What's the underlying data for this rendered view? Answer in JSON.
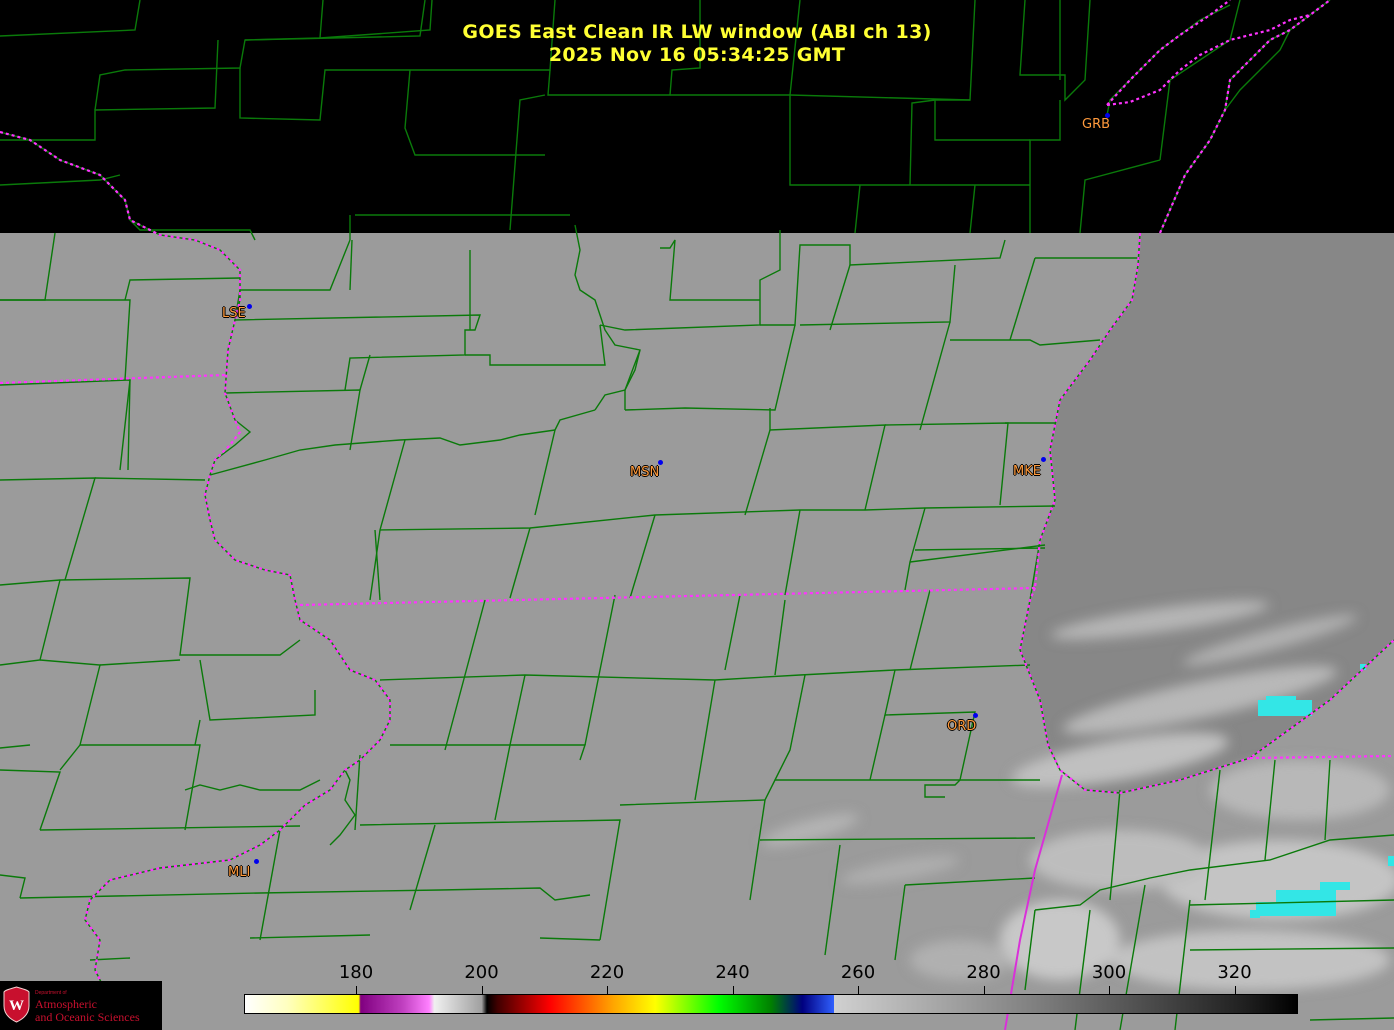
{
  "title": {
    "line1": "GOES East Clean IR LW window (ABI ch 13)",
    "line2": "2025 Nov 16  05:34:25 GMT"
  },
  "stations": [
    {
      "id": "lse",
      "label": "LSE"
    },
    {
      "id": "msn",
      "label": "MSN"
    },
    {
      "id": "mke",
      "label": "MKE"
    },
    {
      "id": "grb",
      "label": "GRB"
    },
    {
      "id": "ord",
      "label": "ORD"
    },
    {
      "id": "mli",
      "label": "MLI"
    }
  ],
  "colorbar": {
    "ticks": [
      "180",
      "200",
      "220",
      "240",
      "260",
      "280",
      "300",
      "320"
    ],
    "colors": {
      "low_white": "#ffffff",
      "yellow": "#ffff00",
      "magenta": "#c040c0",
      "black": "#000000",
      "red": "#ff0000",
      "orange": "#ffa500",
      "green": "#00ff00",
      "navy": "#000080",
      "cyan": "#00ffff",
      "light_gray": "#d0d0d0",
      "dark_gray": "#202020"
    }
  },
  "map": {
    "colors": {
      "no_data": "#000000",
      "land_ir": "#9b9b9b",
      "lake_ir": "#888888",
      "cloud_ir": "#cfcfcf",
      "cold_cloud": "#33e6e6",
      "county_lines": "#0a7a0a",
      "state_lines": "#ff33ff"
    }
  },
  "logo": {
    "dept": "Department of",
    "line1": "Atmospheric",
    "line2": "and Oceanic Sciences"
  }
}
